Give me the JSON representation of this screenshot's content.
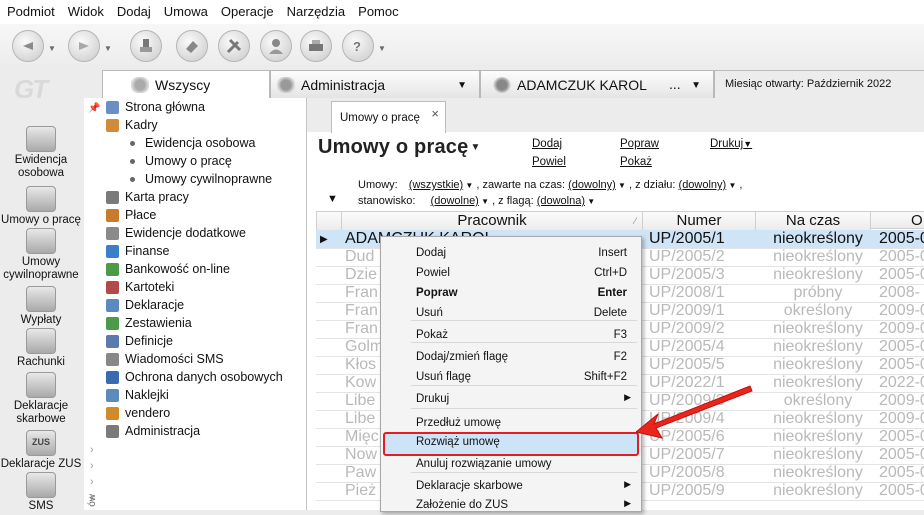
{
  "menubar": [
    "Podmiot",
    "Widok",
    "Dodaj",
    "Umowa",
    "Operacje",
    "Narzędzia",
    "Pomoc"
  ],
  "logo": "GT",
  "toptabs": {
    "all": "Wszyscy",
    "admin": "Administracja",
    "user": "ADAMCZUK KAROL",
    "user_more": "...",
    "month_label": "Miesiąc otwarty:",
    "month_value": "Październik 2022"
  },
  "leftbar": [
    "Ewidencja osobowa",
    "Umowy o pracę",
    "Umowy cywilnoprawne",
    "Wypłaty",
    "Rachunki",
    "Deklaracje skarbowe",
    "Deklaracje ZUS",
    "SMS"
  ],
  "leftbar_icon_text": "ZUS",
  "tree": {
    "items": [
      {
        "label": "Strona główna",
        "icon": "home-icon",
        "color": "#6a8fc7"
      },
      {
        "label": "Kadry",
        "icon": "people-icon",
        "color": "#d08a3a"
      },
      {
        "label": "Ewidencja osobowa",
        "sub": true
      },
      {
        "label": "Umowy o pracę",
        "sub": true
      },
      {
        "label": "Umowy cywilnoprawne",
        "sub": true
      },
      {
        "label": "Karta pracy",
        "icon": "card-icon",
        "color": "#7a7a7a"
      },
      {
        "label": "Płace",
        "icon": "money-icon",
        "color": "#c97a2c"
      },
      {
        "label": "Ewidencje dodatkowe",
        "icon": "list-icon",
        "color": "#8a8a8a"
      },
      {
        "label": "Finanse",
        "icon": "chart-icon",
        "color": "#3a7fc9"
      },
      {
        "label": "Bankowość on-line",
        "icon": "bank-icon",
        "color": "#4a9a4a"
      },
      {
        "label": "Kartoteki",
        "icon": "folder-icon",
        "color": "#b34a4a"
      },
      {
        "label": "Deklaracje",
        "icon": "document-icon",
        "color": "#5a8ac0"
      },
      {
        "label": "Zestawienia",
        "icon": "report-icon",
        "color": "#4a9a4a"
      },
      {
        "label": "Definicje",
        "icon": "gear-icon",
        "color": "#5a7ab0"
      },
      {
        "label": "Wiadomości SMS",
        "icon": "sms-icon",
        "color": "#888888"
      },
      {
        "label": "Ochrona danych osobowych",
        "icon": "shield-icon",
        "color": "#3a6ab0"
      },
      {
        "label": "Naklejki",
        "icon": "label-icon",
        "color": "#5a8ac0"
      },
      {
        "label": "vendero",
        "icon": "vendero-icon",
        "color": "#d08a2a"
      },
      {
        "label": "Administracja",
        "icon": "admin-icon",
        "color": "#7a7a7a"
      }
    ],
    "vertical_label": "ów"
  },
  "doctab": {
    "label": "Umowy o pracę",
    "close": "×"
  },
  "title": "Umowy o pracę",
  "actions": {
    "dodaj": "Dodaj",
    "popraw": "Popraw",
    "drukuj": "Drukuj",
    "powiel": "Powiel",
    "pokaz": "Pokaż"
  },
  "filters": {
    "line1_prefix": "Umowy:",
    "umowy": "(wszystkie)",
    "zawarte_label": ", zawarte na czas:",
    "zawarte": "(dowolny)",
    "dzial_label": ", z działu:",
    "dzial": "(dowolny)",
    "line1_end": ",",
    "stanowisko_label": "stanowisko:",
    "stanowisko": "(dowolne)",
    "flaga_label": ", z flagą:",
    "flaga": "(dowolna)"
  },
  "grid": {
    "headers": [
      "Pracownik",
      "Numer",
      "Na czas",
      "O"
    ],
    "rows": [
      {
        "name": "ADAMCZUK KAROL",
        "num": "UP/2005/1",
        "czas": "nieokreślony",
        "o": "2005-0",
        "selected": true
      },
      {
        "name": "Dud",
        "num": "UP/2005/2",
        "czas": "nieokreślony",
        "o": "2005-0"
      },
      {
        "name": "Dzie",
        "num": "UP/2005/3",
        "czas": "nieokreślony",
        "o": "2005-0"
      },
      {
        "name": "Fran",
        "num": "UP/2008/1",
        "czas": "próbny",
        "o": "2008-"
      },
      {
        "name": "Fran",
        "num": "UP/2009/1",
        "czas": "określony",
        "o": "2009-0"
      },
      {
        "name": "Fran",
        "num": "UP/2009/2",
        "czas": "nieokreślony",
        "o": "2009-0"
      },
      {
        "name": "Golm",
        "num": "UP/2005/4",
        "czas": "nieokreślony",
        "o": "2005-0"
      },
      {
        "name": "Kłos",
        "num": "UP/2005/5",
        "czas": "nieokreślony",
        "o": "2005-0"
      },
      {
        "name": "Kow",
        "num": "UP/2022/1",
        "czas": "nieokreślony",
        "o": "2022-0"
      },
      {
        "name": "Libe",
        "num": "UP/2009/3",
        "czas": "określony",
        "o": "2009-0"
      },
      {
        "name": "Libe",
        "num": "UP/2009/4",
        "czas": "nieokreślony",
        "o": "2009-0"
      },
      {
        "name": "Mięc",
        "num": "UP/2005/6",
        "czas": "nieokreślony",
        "o": "2005-0"
      },
      {
        "name": "Now",
        "num": "UP/2005/7",
        "czas": "nieokreślony",
        "o": "2005-0"
      },
      {
        "name": "Paw",
        "num": "UP/2005/8",
        "czas": "nieokreślony",
        "o": "2005-0"
      },
      {
        "name": "Pież",
        "num": "UP/2005/9",
        "czas": "nieokreślony",
        "o": "2005-0"
      }
    ]
  },
  "context_menu": {
    "items": [
      {
        "label": "Dodaj",
        "key": "Insert"
      },
      {
        "label": "Powiel",
        "key": "Ctrl+D"
      },
      {
        "label": "Popraw",
        "key": "Enter",
        "bold": true
      },
      {
        "label": "Usuń",
        "key": "Delete"
      },
      {
        "label": "Pokaż",
        "key": "F3"
      },
      {
        "label": "Dodaj/zmień flagę",
        "key": "F2"
      },
      {
        "label": "Usuń flagę",
        "key": "Shift+F2"
      },
      {
        "label": "Drukuj",
        "submenu": true
      },
      {
        "label": "Przedłuż umowę"
      },
      {
        "label": "Rozwiąż umowę",
        "highlight": true
      },
      {
        "label": "Anuluj rozwiązanie umowy"
      },
      {
        "label": "Deklaracje skarbowe",
        "submenu": true
      },
      {
        "label": "Założenie do ZUS",
        "submenu": true
      }
    ]
  },
  "colors": {
    "accent_red": "#e02020",
    "selection": "#cfe4f7",
    "menu_highlight": "#cde3f7"
  }
}
